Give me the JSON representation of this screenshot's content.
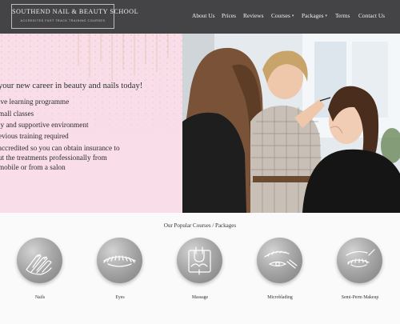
{
  "header": {
    "logo_title": "SOUTHEND NAIL & BEAUTY SCHOOL",
    "logo_subtitle": "ACCREDITED FAST TRACK TRAINING COURSES",
    "nav": [
      {
        "label": "About Us"
      },
      {
        "label": "Prices"
      },
      {
        "label": "Reviews"
      },
      {
        "label": "Courses",
        "has_dropdown": true
      },
      {
        "label": "Packages",
        "has_dropdown": true
      },
      {
        "label": "Terms"
      },
      {
        "label": "Contact Us"
      }
    ],
    "dropdown_icon": "chevron-down-icon",
    "background_color": "#444446"
  },
  "hero": {
    "headline": "your new career in beauty and nails today!",
    "bullets": [
      "ive learning programme",
      "mall classes",
      "ly and supportive environment",
      "evious training required",
      "accredited so you can obtain insurance to",
      "ut the treatments professionally from",
      "mobile or from a salon"
    ],
    "background_color": "#f9dde9",
    "photo": "makeup-artist-training-photo"
  },
  "courses": {
    "title": "Our Popular Courses / Packages",
    "items": [
      {
        "label": "Nails",
        "icon": "nails-icon"
      },
      {
        "label": "Eyes",
        "icon": "eyelash-icon"
      },
      {
        "label": "Massage",
        "icon": "massage-icon"
      },
      {
        "label": "Microblading",
        "icon": "eyebrow-icon"
      },
      {
        "label": "Semi-Perm Makeup",
        "icon": "semi-perm-icon"
      }
    ]
  }
}
